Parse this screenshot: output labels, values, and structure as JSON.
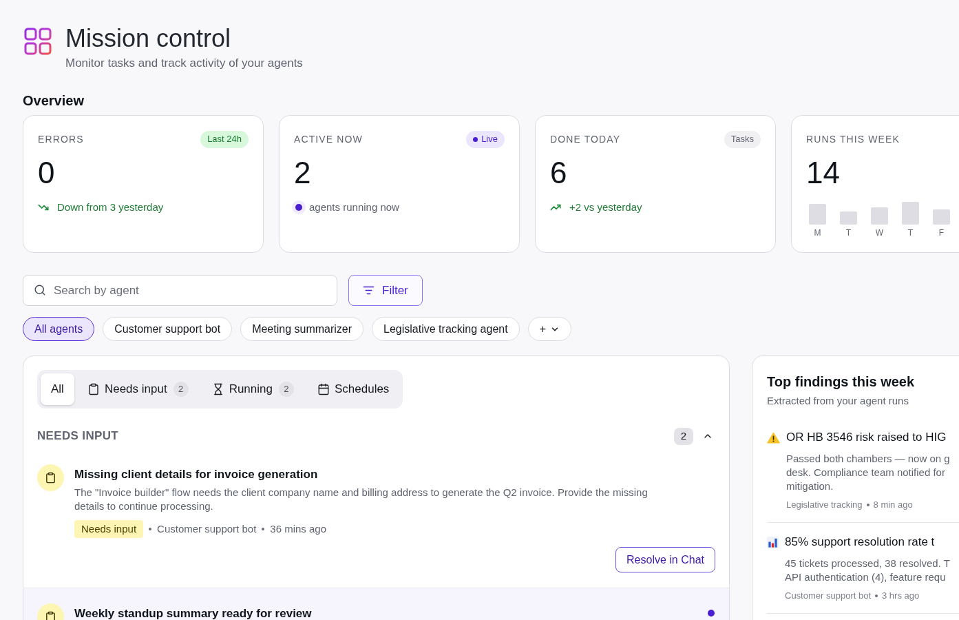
{
  "header": {
    "title": "Mission control",
    "subtitle": "Monitor tasks and track activity of your agents"
  },
  "overview": {
    "title": "Overview",
    "cards": [
      {
        "kind": "decrease",
        "label": "ERRORS",
        "badge": {
          "kind": "success",
          "text": "Last 24h"
        },
        "value": "0",
        "note": "Down from 3 yesterday"
      },
      {
        "kind": "status",
        "label": "ACTIVE NOW",
        "badge": {
          "kind": "live",
          "text": "Live"
        },
        "value": "2",
        "note": "agents running now"
      },
      {
        "kind": "increase",
        "label": "DONE TODAY",
        "badge": {
          "kind": "neutral",
          "text": "Tasks"
        },
        "value": "6",
        "note": "+2 vs yesterday"
      },
      {
        "kind": "bars",
        "label": "RUNS THIS WEEK",
        "value": "14",
        "days": [
          "M",
          "T",
          "W",
          "T",
          "F"
        ]
      }
    ]
  },
  "search": {
    "placeholder": "Search by agent"
  },
  "filter_button": {
    "label": "Filter"
  },
  "agent_chips": [
    {
      "label": "All agents",
      "selected": true
    },
    {
      "label": "Customer support bot",
      "selected": false
    },
    {
      "label": "Meeting summarizer",
      "selected": false
    },
    {
      "label": "Legislative tracking agent",
      "selected": false
    }
  ],
  "more_chip": {
    "label": "+"
  },
  "tasks": {
    "tabs": [
      {
        "label": "All",
        "selected": true
      },
      {
        "label": "Needs input",
        "count": "2",
        "selected": false
      },
      {
        "label": "Running",
        "count": "2",
        "selected": false
      },
      {
        "label": "Schedules",
        "selected": false
      }
    ],
    "section": {
      "title": "NEEDS INPUT",
      "count": "2",
      "expanded": true,
      "items": [
        {
          "title": "Missing client details for invoice generation",
          "description": "The \"Invoice builder\" flow needs the client company name and billing address to generate the Q2 invoice. Provide the missing details to continue processing.",
          "tag": "Needs input",
          "agent": "Customer support bot",
          "time": "36 mins ago",
          "action": "Resolve in Chat",
          "unread": false
        },
        {
          "title": "Weekly standup summary ready for review",
          "unread": true
        }
      ]
    }
  },
  "findings": {
    "title": "Top findings this week",
    "subtitle": "Extracted from your agent runs",
    "items": [
      {
        "kind": "warning",
        "title": "OR HB 3546 risk raised to HIG",
        "lines": [
          "Passed both chambers — now on g",
          "desk. Compliance team notified for",
          "mitigation."
        ],
        "source": "Legislative tracking",
        "time": "8 min ago"
      },
      {
        "kind": "chart",
        "title": "85% support resolution rate t",
        "lines": [
          "45 tickets processed, 38 resolved. T",
          "API authentication (4), feature requ"
        ],
        "source": "Customer support bot",
        "time": "3 hrs ago"
      }
    ]
  }
}
